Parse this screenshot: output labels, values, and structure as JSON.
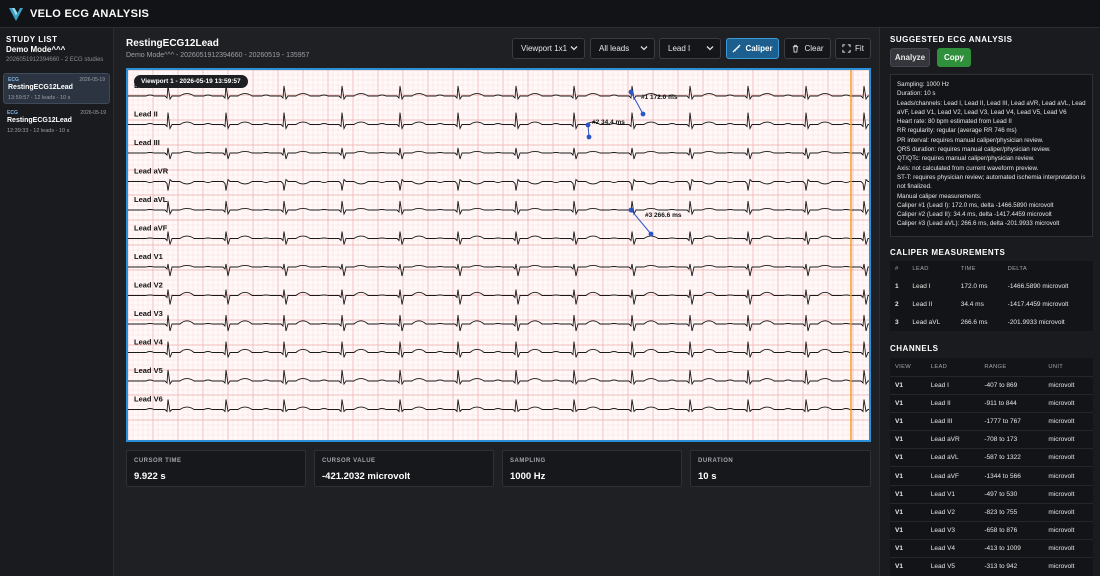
{
  "app": {
    "title": "VELO ECG ANALYSIS"
  },
  "sidebar": {
    "header": "STUDY LIST",
    "mode": "Demo Mode^^^",
    "mode_sub": "2026051912394660 - 2 ECG studies",
    "studies": [
      {
        "tag": "ECG",
        "date": "2026-05-19",
        "name": "RestingECG12Lead",
        "meta": "13:59:57 - 12 leads - 10 s"
      },
      {
        "tag": "ECG",
        "date": "2026-05-19",
        "name": "RestingECG12Lead",
        "meta": "12:39:33 - 12 leads - 10 s"
      }
    ]
  },
  "record": {
    "title": "RestingECG12Lead",
    "subtitle": "Demo Mode^^^ - 2026051912394660 - 20260519 - 135957"
  },
  "toolbar": {
    "viewport": "Viewport 1x1",
    "leads": "All leads",
    "lead": "Lead I",
    "caliper": "Caliper",
    "clear": "Clear",
    "fit": "Fit"
  },
  "viewer": {
    "badge": "Viewport 1 - 2026-05-19 13:59:57",
    "leads": [
      "Lead I",
      "Lead II",
      "Lead III",
      "Lead aVR",
      "Lead aVL",
      "Lead aVF",
      "Lead V1",
      "Lead V2",
      "Lead V3",
      "Lead V4",
      "Lead V5",
      "Lead V6"
    ],
    "calipers": [
      {
        "label": "#1 172.0 ms"
      },
      {
        "label": "#2 34.4 ms"
      },
      {
        "label": "#3 266.6 ms"
      }
    ],
    "colors": {
      "grid_minor": "#f7d6d6",
      "grid_major": "#eeaaaa",
      "trace": "#1a1a1a",
      "cursor": "#f0a020",
      "caliper": "#2a55c8"
    }
  },
  "stats": [
    {
      "label": "CURSOR TIME",
      "value": "9.922 s"
    },
    {
      "label": "CURSOR VALUE",
      "value": "-421.2032 microvolt"
    },
    {
      "label": "SAMPLING",
      "value": "1000 Hz"
    },
    {
      "label": "DURATION",
      "value": "10 s"
    }
  ],
  "analysis": {
    "header": "SUGGESTED ECG ANALYSIS",
    "analyze": "Analyze",
    "copy": "Copy",
    "lines": [
      "Sampling: 1000 Hz",
      "Duration: 10 s",
      "Leads/channels: Lead I, Lead II, Lead III, Lead aVR, Lead aVL, Lead aVF, Lead V1, Lead V2, Lead V3, Lead V4, Lead V5, Lead V6",
      "Heart rate: 80 bpm estimated from Lead II",
      "RR regularity: regular (average RR 746 ms)",
      "PR interval: requires manual caliper/physician review.",
      "QRS duration: requires manual caliper/physician review.",
      "QT/QTc: requires manual caliper/physician review.",
      "Axis: not calculated from current waveform preview.",
      "ST-T: requires physician review; automated ischemia interpretation is not finalized.",
      "Manual caliper measurements:",
      "Caliper #1 (Lead I): 172.0 ms, delta -1466.5890 microvolt",
      "Caliper #2 (Lead II): 34.4 ms, delta -1417.4459 microvolt",
      "Caliper #3 (Lead aVL): 266.6 ms, delta -201.9933 microvolt"
    ]
  },
  "caliper_table": {
    "header": "CALIPER MEASUREMENTS",
    "columns": [
      "#",
      "LEAD",
      "TIME",
      "DELTA"
    ],
    "rows": [
      [
        "1",
        "Lead I",
        "172.0 ms",
        "-1466.5890 microvolt"
      ],
      [
        "2",
        "Lead II",
        "34.4 ms",
        "-1417.4459 microvolt"
      ],
      [
        "3",
        "Lead aVL",
        "266.6 ms",
        "-201.9933 microvolt"
      ]
    ]
  },
  "channels": {
    "header": "CHANNELS",
    "columns": [
      "VIEW",
      "LEAD",
      "RANGE",
      "UNIT"
    ],
    "rows": [
      [
        "V1",
        "Lead I",
        "-407 to 869",
        "microvolt"
      ],
      [
        "V1",
        "Lead II",
        "-911 to 844",
        "microvolt"
      ],
      [
        "V1",
        "Lead III",
        "-1777 to 767",
        "microvolt"
      ],
      [
        "V1",
        "Lead aVR",
        "-708 to 173",
        "microvolt"
      ],
      [
        "V1",
        "Lead aVL",
        "-587 to 1322",
        "microvolt"
      ],
      [
        "V1",
        "Lead aVF",
        "-1344 to 566",
        "microvolt"
      ],
      [
        "V1",
        "Lead V1",
        "-497 to 530",
        "microvolt"
      ],
      [
        "V1",
        "Lead V2",
        "-823 to 755",
        "microvolt"
      ],
      [
        "V1",
        "Lead V3",
        "-658 to 876",
        "microvolt"
      ],
      [
        "V1",
        "Lead V4",
        "-413 to 1009",
        "microvolt"
      ],
      [
        "V1",
        "Lead V5",
        "-313 to 942",
        "microvolt"
      ]
    ]
  }
}
